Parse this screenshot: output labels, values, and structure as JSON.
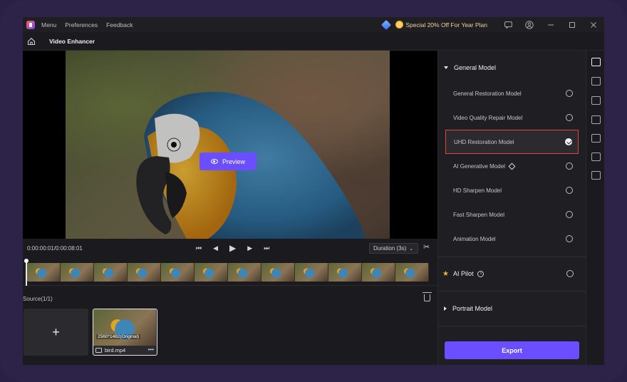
{
  "titlebar": {
    "menus": [
      "Menu",
      "Preferences",
      "Feedback"
    ],
    "promo": "Special 20% Off For Year Plan",
    "icons": [
      "gem-icon",
      "sun-badge-icon",
      "chat-icon",
      "account-icon",
      "minimize-icon",
      "maximize-icon",
      "close-icon"
    ]
  },
  "header": {
    "title": "Video Enhancer"
  },
  "viewer": {
    "preview_label": "Preview"
  },
  "controls": {
    "time": "0:00:00:01/0:00:08:01",
    "duration": "Duration (3s)"
  },
  "timeline": {
    "frames": 12
  },
  "source": {
    "label": "Source(1/1)",
    "add_label": "+",
    "clip": {
      "resolution": "2560*1482(Original)",
      "name": "bird.mp4",
      "more": "•••"
    }
  },
  "panel": {
    "general_model": "General Model",
    "models": [
      {
        "label": "General Restoration Model",
        "selected": false
      },
      {
        "label": "Video Quality Repair Model",
        "selected": false
      },
      {
        "label": "UHD Restoration Model",
        "selected": true
      },
      {
        "label": "AI Generative Model",
        "selected": false
      },
      {
        "label": "HD Sharpen Model",
        "selected": false
      },
      {
        "label": "Fast Sharpen Model",
        "selected": false
      },
      {
        "label": "Animation Model",
        "selected": false
      }
    ],
    "ai_pilot": "AI Pilot",
    "portrait_model": "Portrait Model",
    "export_label": "Export"
  },
  "colors": {
    "accent": "#6b4eff",
    "selected_border": "#e0463a",
    "promo": "#f0d39a"
  }
}
